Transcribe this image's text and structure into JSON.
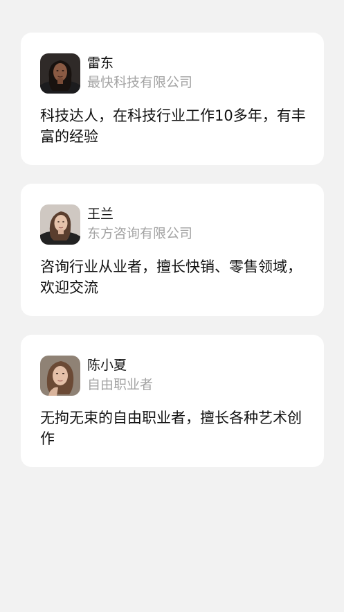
{
  "contacts": [
    {
      "name": "雷东",
      "company": "最快科技有限公司",
      "description": "科技达人，在科技行业工作10多年，有丰富的经验",
      "avatar_icon": "person-photo-icon"
    },
    {
      "name": "王兰",
      "company": "东方咨询有限公司",
      "description": "咨询行业从业者，擅长快销、零售领域，欢迎交流",
      "avatar_icon": "person-photo-icon"
    },
    {
      "name": "陈小夏",
      "company": "自由职业者",
      "description": "无拘无束的自由职业者，擅长各种艺术创作",
      "avatar_icon": "person-photo-icon"
    }
  ],
  "colors": {
    "background": "#f2f2f2",
    "card": "#ffffff",
    "primary_text": "#111111",
    "secondary_text": "#a3a3a3"
  }
}
